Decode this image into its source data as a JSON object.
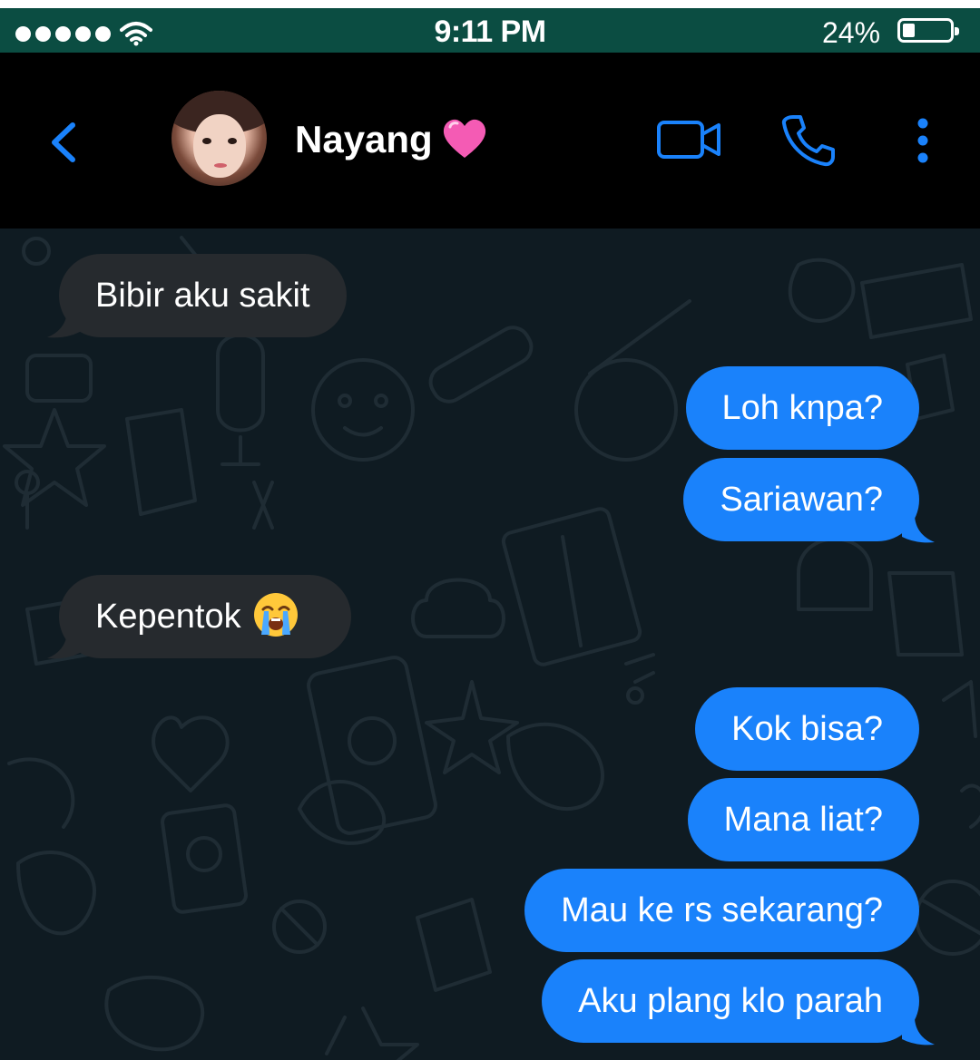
{
  "status_bar": {
    "time": "9:11 PM",
    "battery_percent": "24%",
    "battery_level": 0.24,
    "signal_bars": 5,
    "colors": {
      "background": "#0b4d42",
      "text": "#ffffff"
    }
  },
  "header": {
    "contact_name": "Nayang",
    "name_emoji": "pink-heart-emoji",
    "icons": [
      "back-chevron-icon",
      "video-camera-icon",
      "phone-icon",
      "more-vertical-icon"
    ],
    "accent_color": "#1a82fb"
  },
  "messages": [
    {
      "direction": "incoming",
      "text": "Bibir aku sakit"
    },
    {
      "direction": "outgoing",
      "text": "Loh knpa?"
    },
    {
      "direction": "outgoing",
      "text": "Sariawan?"
    },
    {
      "direction": "incoming",
      "text": "Kepentok",
      "emoji": "loudly-crying-face-emoji"
    },
    {
      "direction": "outgoing",
      "text": "Kok bisa?"
    },
    {
      "direction": "outgoing",
      "text": "Mana liat?"
    },
    {
      "direction": "outgoing",
      "text": "Mau ke rs sekarang?"
    },
    {
      "direction": "outgoing",
      "text": "Aku plang klo parah"
    }
  ],
  "colors": {
    "outgoing_bubble": "#1a82fb",
    "incoming_bubble": "#262a2e",
    "chat_background": "#0f1b22",
    "header_background": "#000000"
  }
}
